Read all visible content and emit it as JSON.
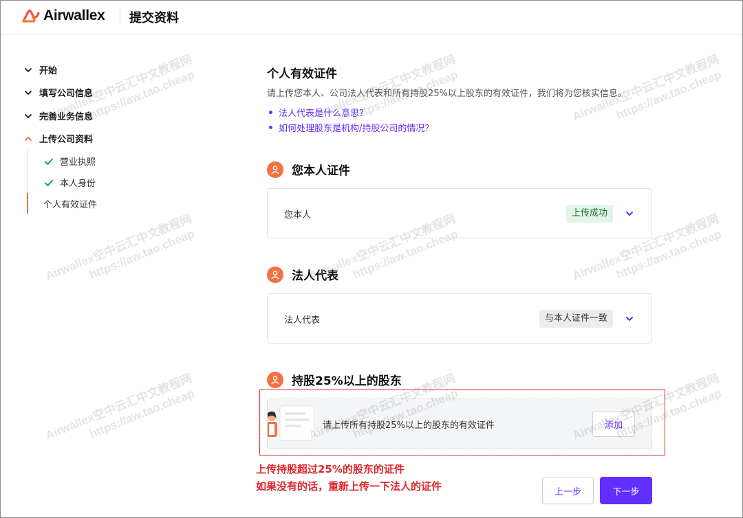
{
  "header": {
    "brand": "Airwallex",
    "title": "提交资料"
  },
  "sidebar": {
    "steps": [
      {
        "label": "开始",
        "state": "collapsed"
      },
      {
        "label": "填写公司信息",
        "state": "collapsed"
      },
      {
        "label": "完善业务信息",
        "state": "collapsed"
      },
      {
        "label": "上传公司资料",
        "state": "expanded"
      }
    ],
    "substeps": [
      {
        "label": "营业执照",
        "done": true
      },
      {
        "label": "本人身份",
        "done": true
      },
      {
        "label": "个人有效证件",
        "done": false,
        "active": true
      }
    ]
  },
  "main": {
    "title": "个人有效证件",
    "description": "请上传您本人、公司法人代表和所有持股25%以上股东的有效证件，我们将为您核实信息。",
    "links": [
      "法人代表是什么意思？",
      "如何处理股东是机构/持股公司的情况？"
    ],
    "sections": {
      "self": {
        "title": "您本人证件",
        "row_label": "您本人",
        "badge": "上传成功"
      },
      "legal": {
        "title": "法人代表",
        "row_label": "法人代表",
        "badge": "与本人证件一致"
      },
      "shareholders": {
        "title": "持股25%以上的股东",
        "upload_text": "请上传所有持股25%以上的股东的有效证件",
        "add_label": "添加"
      }
    },
    "annotation": {
      "line1": "上传持股超过25%的股东的证件",
      "line2": "如果没有的话，重新上传一下法人的证件"
    },
    "buttons": {
      "prev": "上一步",
      "next": "下一步"
    }
  },
  "watermark": {
    "line1": "Airwallex空中云汇中文教程网",
    "line2": "https://aw.tao.cheap"
  },
  "colors": {
    "accent": "#612fff",
    "brand_orange": "#f47240",
    "success": "#1aa34a",
    "annotation_red": "#e0262a"
  }
}
